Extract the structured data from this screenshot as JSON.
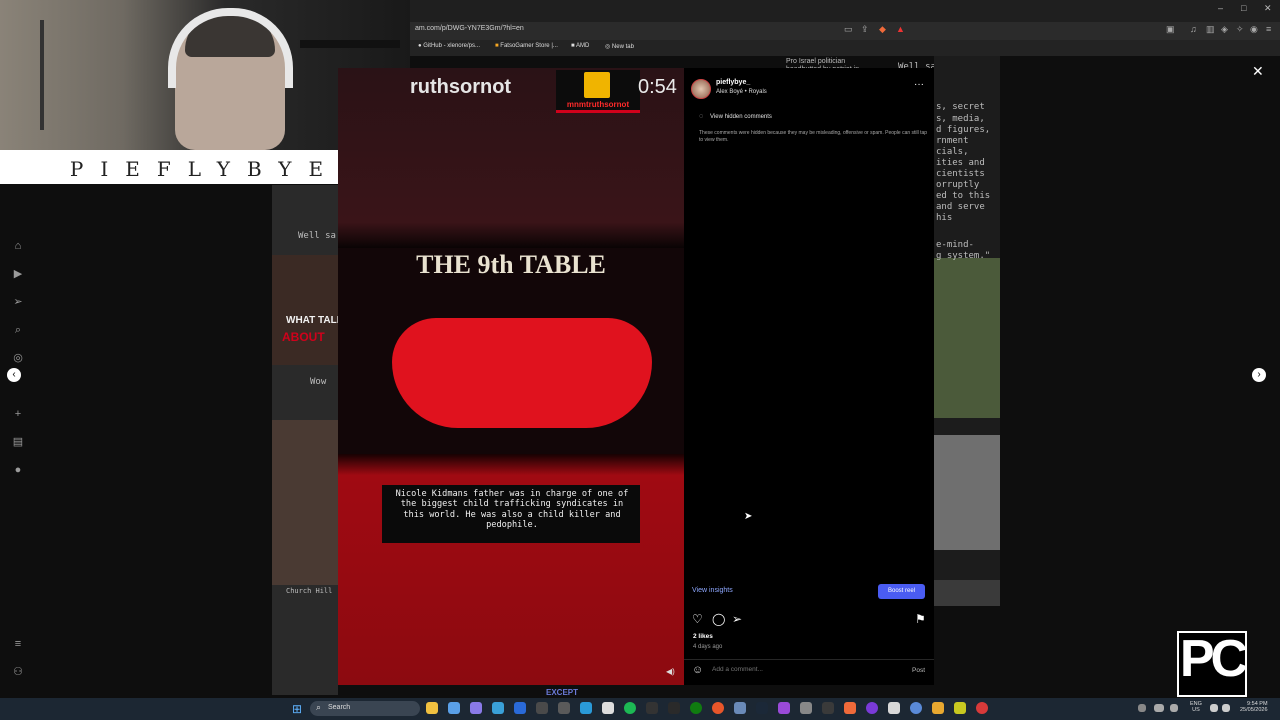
{
  "browser": {
    "url": "am.com/p/DWG-YN7E3Gm/?hl=en",
    "bookmarks": [
      "GitHub - xlenore/ps...",
      "FatsoGamer Store |...",
      "AMD",
      "New tab"
    ]
  },
  "webcam": {
    "nameplate": "PIEFLYBYE"
  },
  "background_feed": {
    "texts": [
      "Pro Israel politician headbutted by patriot in",
      "Well said all",
      "Well sa",
      "Wow",
      "WHAT TALK",
      "ABOUT",
      "Church Hill",
      "EXCEPT",
      "s, secret",
      "s, media,",
      "d figures,",
      "rnment",
      "cials,",
      "ities and",
      "cientists",
      "orruptly",
      "ed to this",
      "and serve",
      "his",
      "e-mind-",
      "g system.\""
    ],
    "accent": "#d0011b"
  },
  "reel": {
    "handle": "ruthsornot",
    "timer": "0:54",
    "logo_text": "mnmtruthsornot",
    "scene_title": "THE 9th TABLE",
    "caption": "Nicole Kidmans father was in charge of one of the biggest child trafficking syndicates in this world. He was also a child killer and pedophile."
  },
  "post": {
    "username": "pieflybye_",
    "audio": "Alex Boyé • Royals",
    "hidden_comments_link": "View hidden comments",
    "hidden_comments_desc": "These comments were hidden because they may be misleading, offensive or spam. People can still tap to view them.",
    "view_insights": "View insights",
    "boost_label": "Boost reel",
    "likes": "2 likes",
    "posted": "4 days ago",
    "comment_placeholder": "Add a comment...",
    "post_label": "Post"
  },
  "overlay_logo": "PC",
  "taskbar": {
    "search_label": "Search",
    "lang_line1": "ENG",
    "lang_line2": "US",
    "time": "9:54 PM",
    "date": "25/05/2026"
  },
  "colors": {
    "accent_blue": "#4a5cf2",
    "link_blue": "#8ea8ff",
    "reel_red": "#e0121e"
  }
}
